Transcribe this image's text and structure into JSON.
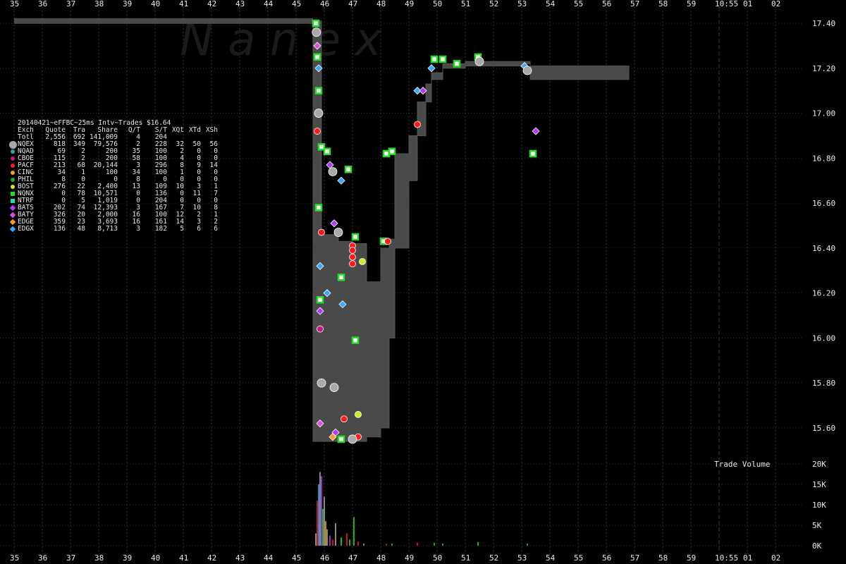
{
  "legend": {
    "title": "20140421~eFFBC~25ms Intv~Trades $16.64",
    "header": [
      "Exch",
      "Quote",
      "Tra",
      "Share",
      "Q/T",
      "S/T",
      "XQt",
      "XTd",
      "XSh"
    ],
    "rows": [
      {
        "marker": "none",
        "color": "",
        "cells": [
          "Totl",
          "2,556",
          "692",
          "141,009",
          "4",
          "204",
          "",
          "",
          ""
        ]
      },
      {
        "marker": "circle-big",
        "color": "#a9a9a9",
        "cells": [
          "NQEX",
          "818",
          "349",
          "79,576",
          "2",
          "228",
          "32",
          "50",
          "56"
        ]
      },
      {
        "marker": "circle",
        "color": "#22aaaa",
        "cells": [
          "NQAD",
          "69",
          "2",
          "200",
          "35",
          "100",
          "2",
          "0",
          "0"
        ]
      },
      {
        "marker": "circle",
        "color": "#c71585",
        "cells": [
          "CBOE",
          "115",
          "2",
          "200",
          "58",
          "100",
          "4",
          "0",
          "0"
        ]
      },
      {
        "marker": "circle",
        "color": "#ff1a1a",
        "cells": [
          "PACF",
          "213",
          "68",
          "20,144",
          "3",
          "296",
          "8",
          "9",
          "14"
        ]
      },
      {
        "marker": "circle",
        "color": "#ff9a1f",
        "cells": [
          "CINC",
          "34",
          "1",
          "100",
          "34",
          "100",
          "1",
          "0",
          "0"
        ]
      },
      {
        "marker": "circle",
        "color": "#22aa22",
        "cells": [
          "PHIL",
          "8",
          "0",
          "0",
          "8",
          "0",
          "0",
          "0",
          "0"
        ]
      },
      {
        "marker": "circle",
        "color": "#ccee22",
        "cells": [
          "BOST",
          "276",
          "22",
          "2,400",
          "13",
          "109",
          "10",
          "3",
          "1"
        ]
      },
      {
        "marker": "square",
        "color": "#22dd22",
        "cells": [
          "NQNX",
          "0",
          "78",
          "10,571",
          "0",
          "136",
          "0",
          "11",
          "7"
        ]
      },
      {
        "marker": "square",
        "color": "#22ddaa",
        "cells": [
          "NTRF",
          "0",
          "5",
          "1,019",
          "0",
          "204",
          "0",
          "0",
          "0"
        ]
      },
      {
        "marker": "diamond",
        "color": "#b03aff",
        "cells": [
          "BATS",
          "202",
          "74",
          "12,393",
          "3",
          "167",
          "7",
          "10",
          "8"
        ]
      },
      {
        "marker": "diamond",
        "color": "#e04fd9",
        "cells": [
          "BATY",
          "326",
          "20",
          "2,000",
          "16",
          "100",
          "12",
          "2",
          "1"
        ]
      },
      {
        "marker": "diamond",
        "color": "#ff9a1f",
        "cells": [
          "EDGE",
          "359",
          "23",
          "3,693",
          "16",
          "161",
          "14",
          "3",
          "2"
        ]
      },
      {
        "marker": "diamond",
        "color": "#33aaff",
        "cells": [
          "EDGX",
          "136",
          "48",
          "8,713",
          "3",
          "182",
          "5",
          "6",
          "6"
        ]
      }
    ]
  },
  "volume_label": "Trade Volume",
  "watermark": "N a n e x",
  "chart_data": {
    "type": "scatter",
    "x_ticks": [
      "35",
      "36",
      "37",
      "38",
      "39",
      "40",
      "41",
      "42",
      "43",
      "44",
      "45",
      "46",
      "47",
      "48",
      "49",
      "50",
      "51",
      "52",
      "53",
      "54",
      "55",
      "56",
      "57",
      "58",
      "59",
      "10:55",
      "01",
      "02"
    ],
    "xlim": [
      35,
      62
    ],
    "price_ticks": [
      "17.40",
      "17.20",
      "17.00",
      "16.80",
      "16.60",
      "16.40",
      "16.20",
      "16.00",
      "15.80",
      "15.60"
    ],
    "price_tick_values": [
      17.4,
      17.2,
      17.0,
      16.8,
      16.6,
      16.4,
      16.2,
      16.0,
      15.8,
      15.6
    ],
    "ylim": [
      15.48,
      17.46
    ],
    "volume_ticks": [
      "20K",
      "15K",
      "10K",
      "5K",
      "0K"
    ],
    "volume_tick_values": [
      20000,
      15000,
      10000,
      5000,
      0
    ],
    "volume_ylim": [
      0,
      20000
    ],
    "nbbo_spread": [
      [
        35.0,
        17.41,
        17.41
      ],
      [
        45.5,
        17.41,
        17.41
      ],
      [
        45.6,
        15.54,
        17.41
      ],
      [
        45.9,
        15.54,
        16.46
      ],
      [
        46.5,
        15.54,
        16.43
      ],
      [
        47.0,
        15.54,
        16.42
      ],
      [
        47.5,
        15.56,
        16.25
      ],
      [
        48.0,
        15.6,
        16.4
      ],
      [
        48.3,
        16.0,
        16.44
      ],
      [
        48.5,
        16.4,
        16.82
      ],
      [
        49.0,
        16.7,
        16.9
      ],
      [
        49.3,
        16.9,
        17.05
      ],
      [
        49.6,
        17.05,
        17.13
      ],
      [
        49.8,
        17.15,
        17.18
      ],
      [
        50.2,
        17.2,
        17.22
      ],
      [
        51.0,
        17.21,
        17.23
      ],
      [
        53.0,
        17.22,
        17.23
      ],
      [
        53.3,
        17.15,
        17.21
      ],
      [
        56.8,
        17.15,
        17.21
      ]
    ],
    "trades": [
      {
        "x": 45.7,
        "y": 17.4,
        "exch": "NQNX"
      },
      {
        "x": 45.72,
        "y": 17.36,
        "exch": "NQEX"
      },
      {
        "x": 45.75,
        "y": 17.3,
        "exch": "BATY"
      },
      {
        "x": 45.75,
        "y": 17.25,
        "exch": "NQNX"
      },
      {
        "x": 45.8,
        "y": 17.2,
        "exch": "EDGX"
      },
      {
        "x": 45.8,
        "y": 17.1,
        "exch": "NQNX"
      },
      {
        "x": 45.8,
        "y": 17.0,
        "exch": "NQEX"
      },
      {
        "x": 45.75,
        "y": 16.92,
        "exch": "PACF"
      },
      {
        "x": 45.9,
        "y": 16.85,
        "exch": "NQNX"
      },
      {
        "x": 46.1,
        "y": 16.83,
        "exch": "NQNX"
      },
      {
        "x": 46.2,
        "y": 16.77,
        "exch": "BATS"
      },
      {
        "x": 46.3,
        "y": 16.74,
        "exch": "NQEX"
      },
      {
        "x": 46.6,
        "y": 16.7,
        "exch": "EDGX"
      },
      {
        "x": 46.85,
        "y": 16.75,
        "exch": "NQNX"
      },
      {
        "x": 45.8,
        "y": 16.58,
        "exch": "NQNX"
      },
      {
        "x": 46.35,
        "y": 16.51,
        "exch": "BATS"
      },
      {
        "x": 46.5,
        "y": 16.47,
        "exch": "NQEX"
      },
      {
        "x": 45.9,
        "y": 16.47,
        "exch": "PACF"
      },
      {
        "x": 47.1,
        "y": 16.45,
        "exch": "NQNX"
      },
      {
        "x": 47.0,
        "y": 16.41,
        "exch": "PACF"
      },
      {
        "x": 47.0,
        "y": 16.39,
        "exch": "PACF"
      },
      {
        "x": 47.0,
        "y": 16.36,
        "exch": "PACF"
      },
      {
        "x": 47.35,
        "y": 16.34,
        "exch": "BOST"
      },
      {
        "x": 45.85,
        "y": 16.32,
        "exch": "EDGX"
      },
      {
        "x": 47.0,
        "y": 16.33,
        "exch": "PACF"
      },
      {
        "x": 46.6,
        "y": 16.27,
        "exch": "NQNX"
      },
      {
        "x": 46.1,
        "y": 16.2,
        "exch": "EDGX"
      },
      {
        "x": 45.85,
        "y": 16.17,
        "exch": "NQNX"
      },
      {
        "x": 45.85,
        "y": 16.12,
        "exch": "BATS"
      },
      {
        "x": 46.65,
        "y": 16.15,
        "exch": "EDGX"
      },
      {
        "x": 45.85,
        "y": 16.04,
        "exch": "CBOE"
      },
      {
        "x": 47.1,
        "y": 15.99,
        "exch": "NQNX"
      },
      {
        "x": 45.9,
        "y": 15.8,
        "exch": "NQEX"
      },
      {
        "x": 46.35,
        "y": 15.78,
        "exch": "NQEX"
      },
      {
        "x": 47.2,
        "y": 15.66,
        "exch": "BOST"
      },
      {
        "x": 46.7,
        "y": 15.64,
        "exch": "PACF"
      },
      {
        "x": 45.85,
        "y": 15.62,
        "exch": "BATY"
      },
      {
        "x": 46.4,
        "y": 15.58,
        "exch": "BATS"
      },
      {
        "x": 46.3,
        "y": 15.56,
        "exch": "EDGE"
      },
      {
        "x": 46.6,
        "y": 15.55,
        "exch": "NQNX"
      },
      {
        "x": 47.2,
        "y": 15.56,
        "exch": "PACF"
      },
      {
        "x": 47.0,
        "y": 15.55,
        "exch": "PACF"
      },
      {
        "x": 47.0,
        "y": 15.55,
        "exch": "NQEX"
      },
      {
        "x": 48.2,
        "y": 16.82,
        "exch": "NQNX"
      },
      {
        "x": 48.4,
        "y": 16.83,
        "exch": "NQNX"
      },
      {
        "x": 48.1,
        "y": 16.43,
        "exch": "NQNX"
      },
      {
        "x": 48.25,
        "y": 16.43,
        "exch": "PACF"
      },
      {
        "x": 49.3,
        "y": 16.95,
        "exch": "PACF"
      },
      {
        "x": 49.3,
        "y": 17.1,
        "exch": "EDGX"
      },
      {
        "x": 49.5,
        "y": 17.1,
        "exch": "BATS"
      },
      {
        "x": 49.9,
        "y": 17.24,
        "exch": "NQNX"
      },
      {
        "x": 49.8,
        "y": 17.2,
        "exch": "EDGX"
      },
      {
        "x": 50.2,
        "y": 17.24,
        "exch": "NQNX"
      },
      {
        "x": 50.7,
        "y": 17.22,
        "exch": "NQNX"
      },
      {
        "x": 51.45,
        "y": 17.25,
        "exch": "NQNX"
      },
      {
        "x": 51.5,
        "y": 17.23,
        "exch": "NQEX"
      },
      {
        "x": 53.1,
        "y": 17.21,
        "exch": "EDGX"
      },
      {
        "x": 53.2,
        "y": 17.19,
        "exch": "NQEX"
      },
      {
        "x": 53.5,
        "y": 16.92,
        "exch": "BATS"
      },
      {
        "x": 53.4,
        "y": 16.82,
        "exch": "NQNX"
      }
    ],
    "volume_bars": [
      {
        "x": 45.7,
        "v": 3000,
        "exch": "NQEX"
      },
      {
        "x": 45.75,
        "v": 11000,
        "exch": "PACF"
      },
      {
        "x": 45.8,
        "v": 15000,
        "exch": "EDGX"
      },
      {
        "x": 45.85,
        "v": 18000,
        "exch": "NQEX"
      },
      {
        "x": 45.9,
        "v": 17000,
        "exch": "BATS"
      },
      {
        "x": 45.95,
        "v": 9000,
        "exch": "NQNX"
      },
      {
        "x": 46.0,
        "v": 12000,
        "exch": "NQEX"
      },
      {
        "x": 46.05,
        "v": 6000,
        "exch": "EDGE"
      },
      {
        "x": 46.1,
        "v": 4000,
        "exch": "NQEX"
      },
      {
        "x": 46.2,
        "v": 2500,
        "exch": "BATS"
      },
      {
        "x": 46.3,
        "v": 1500,
        "exch": "PACF"
      },
      {
        "x": 46.4,
        "v": 5500,
        "exch": "NQEX"
      },
      {
        "x": 46.6,
        "v": 2000,
        "exch": "NQNX"
      },
      {
        "x": 46.8,
        "v": 3000,
        "exch": "PACF"
      },
      {
        "x": 46.9,
        "v": 1500,
        "exch": "NQNX"
      },
      {
        "x": 47.05,
        "v": 7000,
        "exch": "NQNX"
      },
      {
        "x": 47.2,
        "v": 1000,
        "exch": "PACF"
      },
      {
        "x": 47.4,
        "v": 500,
        "exch": "NQEX"
      },
      {
        "x": 48.2,
        "v": 500,
        "exch": "PACF"
      },
      {
        "x": 48.4,
        "v": 500,
        "exch": "NQNX"
      },
      {
        "x": 49.3,
        "v": 700,
        "exch": "PACF"
      },
      {
        "x": 49.9,
        "v": 700,
        "exch": "NQNX"
      },
      {
        "x": 50.2,
        "v": 500,
        "exch": "NQNX"
      },
      {
        "x": 51.45,
        "v": 900,
        "exch": "NQNX"
      },
      {
        "x": 53.2,
        "v": 500,
        "exch": "NQNX"
      }
    ]
  }
}
